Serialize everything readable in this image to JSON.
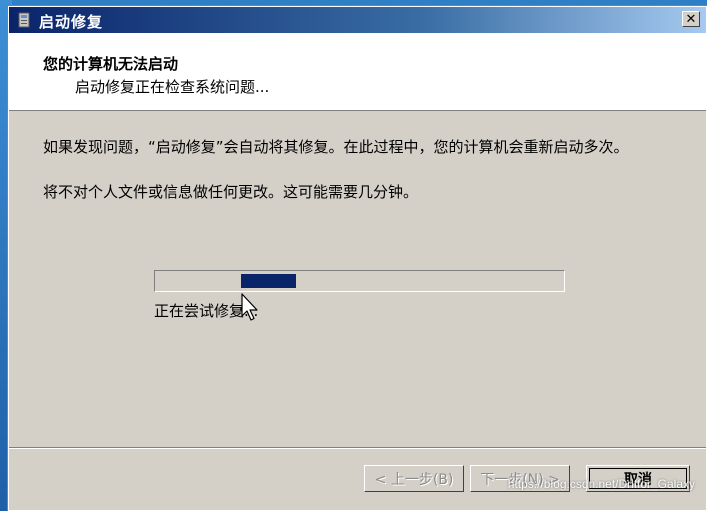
{
  "window": {
    "title": "启动修复",
    "close_glyph": "✕"
  },
  "header": {
    "title": "您的计算机无法启动",
    "subtitle": "启动修复正在检查系统问题..."
  },
  "body": {
    "message1": "如果发现问题，“启动修复”会自动将其修复。在此过程中，您的计算机会重新启动多次。",
    "message2": "将不对个人文件或信息做任何更改。这可能需要几分钟。"
  },
  "progress": {
    "style": "marquee",
    "status": "正在尝试修复..."
  },
  "buttons": {
    "back": "< 上一步(B)",
    "next": "下一步(N) >",
    "cancel": "取消"
  },
  "watermark": "https://blog.csdn.net/Driffor_Galaxy",
  "colors": {
    "titlebar": "#0a246a",
    "dialog_bg": "#d4d0c8",
    "progress_chunk": "#0a246a",
    "desktop": "#2f7fc6"
  },
  "icons": {
    "app": "startup-repair-icon",
    "close": "close-icon",
    "cursor": "mouse-pointer-icon"
  }
}
